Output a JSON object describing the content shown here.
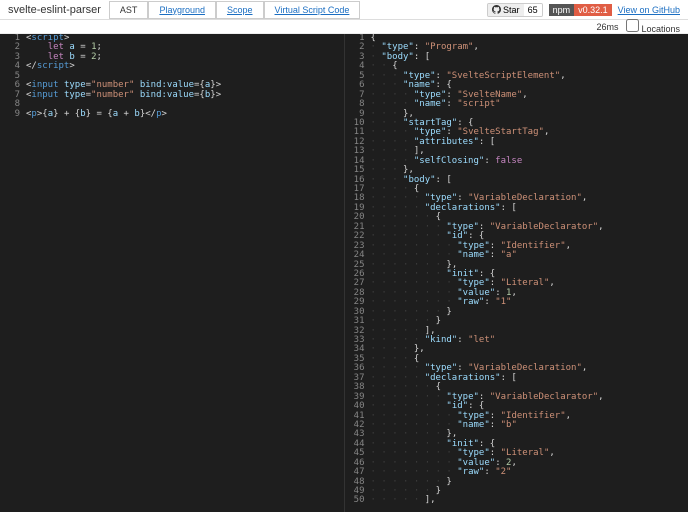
{
  "header": {
    "title": "svelte-eslint-parser",
    "tabs": [
      "AST",
      "Playground",
      "Scope",
      "Virtual Script Code"
    ],
    "activeTab": 0,
    "github": {
      "label": "Star",
      "count": "65"
    },
    "npm": {
      "name": "npm",
      "version": "v0.32.1"
    },
    "viewLink": "View on GitHub"
  },
  "stats": {
    "time": "26ms",
    "locationsLabel": "Locations"
  },
  "leftEditor": [
    {
      "n": 1,
      "h": "<span class='tok-punc'>&lt;</span><span class='tok-tag'>script</span><span class='tok-punc'>&gt;</span>"
    },
    {
      "n": 2,
      "h": "    <span class='tok-kw'>let</span> <span class='tok-var'>a</span> = <span class='tok-num'>1</span>;"
    },
    {
      "n": 3,
      "h": "    <span class='tok-kw'>let</span> <span class='tok-var'>b</span> = <span class='tok-num'>2</span>;"
    },
    {
      "n": 4,
      "h": "<span class='tok-punc'>&lt;/</span><span class='tok-tag'>script</span><span class='tok-punc'>&gt;</span>"
    },
    {
      "n": 5,
      "h": ""
    },
    {
      "n": 6,
      "h": "<span class='tok-punc'>&lt;</span><span class='tok-tag'>input</span> <span class='tok-attr'>type</span>=<span class='tok-str'>\"number\"</span> <span class='tok-attr'>bind:value</span>={<span class='tok-var'>a</span>}<span class='tok-punc'>&gt;</span>"
    },
    {
      "n": 7,
      "h": "<span class='tok-punc'>&lt;</span><span class='tok-tag'>input</span> <span class='tok-attr'>type</span>=<span class='tok-str'>\"number\"</span> <span class='tok-attr'>bind:value</span>={<span class='tok-var'>b</span>}<span class='tok-punc'>&gt;</span>"
    },
    {
      "n": 8,
      "h": ""
    },
    {
      "n": 9,
      "h": "<span class='tok-punc'>&lt;</span><span class='tok-tag'>p</span><span class='tok-punc'>&gt;</span>{<span class='tok-var'>a</span>} + {<span class='tok-var'>b</span>} = {<span class='tok-var'>a</span> + <span class='tok-var'>b</span>}<span class='tok-punc'>&lt;/</span><span class='tok-tag'>p</span><span class='tok-punc'>&gt;</span>"
    }
  ],
  "rightEditor": [
    {
      "n": 1,
      "i": 0,
      "t": "{"
    },
    {
      "n": 2,
      "i": 1,
      "t": "\"type\": \"Program\","
    },
    {
      "n": 3,
      "i": 1,
      "t": "\"body\": ["
    },
    {
      "n": 4,
      "i": 2,
      "t": "{"
    },
    {
      "n": 5,
      "i": 3,
      "t": "\"type\": \"SvelteScriptElement\","
    },
    {
      "n": 6,
      "i": 3,
      "t": "\"name\": {"
    },
    {
      "n": 7,
      "i": 4,
      "t": "\"type\": \"SvelteName\","
    },
    {
      "n": 8,
      "i": 4,
      "t": "\"name\": \"script\""
    },
    {
      "n": 9,
      "i": 3,
      "t": "},"
    },
    {
      "n": 10,
      "i": 3,
      "t": "\"startTag\": {"
    },
    {
      "n": 11,
      "i": 4,
      "t": "\"type\": \"SvelteStartTag\","
    },
    {
      "n": 12,
      "i": 4,
      "t": "\"attributes\": ["
    },
    {
      "n": 13,
      "i": 4,
      "t": "],"
    },
    {
      "n": 14,
      "i": 4,
      "t": "\"selfClosing\": false"
    },
    {
      "n": 15,
      "i": 3,
      "t": "},"
    },
    {
      "n": 16,
      "i": 3,
      "t": "\"body\": ["
    },
    {
      "n": 17,
      "i": 4,
      "t": "{"
    },
    {
      "n": 18,
      "i": 5,
      "t": "\"type\": \"VariableDeclaration\","
    },
    {
      "n": 19,
      "i": 5,
      "t": "\"declarations\": ["
    },
    {
      "n": 20,
      "i": 6,
      "t": "{"
    },
    {
      "n": 21,
      "i": 7,
      "t": "\"type\": \"VariableDeclarator\","
    },
    {
      "n": 22,
      "i": 7,
      "t": "\"id\": {"
    },
    {
      "n": 23,
      "i": 8,
      "t": "\"type\": \"Identifier\","
    },
    {
      "n": 24,
      "i": 8,
      "t": "\"name\": \"a\""
    },
    {
      "n": 25,
      "i": 7,
      "t": "},"
    },
    {
      "n": 26,
      "i": 7,
      "t": "\"init\": {"
    },
    {
      "n": 27,
      "i": 8,
      "t": "\"type\": \"Literal\","
    },
    {
      "n": 28,
      "i": 8,
      "t": "\"value\": 1,"
    },
    {
      "n": 29,
      "i": 8,
      "t": "\"raw\": \"1\""
    },
    {
      "n": 30,
      "i": 7,
      "t": "}"
    },
    {
      "n": 31,
      "i": 6,
      "t": "}"
    },
    {
      "n": 32,
      "i": 5,
      "t": "],"
    },
    {
      "n": 33,
      "i": 5,
      "t": "\"kind\": \"let\""
    },
    {
      "n": 34,
      "i": 4,
      "t": "},"
    },
    {
      "n": 35,
      "i": 4,
      "t": "{"
    },
    {
      "n": 36,
      "i": 5,
      "t": "\"type\": \"VariableDeclaration\","
    },
    {
      "n": 37,
      "i": 5,
      "t": "\"declarations\": ["
    },
    {
      "n": 38,
      "i": 6,
      "t": "{"
    },
    {
      "n": 39,
      "i": 7,
      "t": "\"type\": \"VariableDeclarator\","
    },
    {
      "n": 40,
      "i": 7,
      "t": "\"id\": {"
    },
    {
      "n": 41,
      "i": 8,
      "t": "\"type\": \"Identifier\","
    },
    {
      "n": 42,
      "i": 8,
      "t": "\"name\": \"b\""
    },
    {
      "n": 43,
      "i": 7,
      "t": "},"
    },
    {
      "n": 44,
      "i": 7,
      "t": "\"init\": {"
    },
    {
      "n": 45,
      "i": 8,
      "t": "\"type\": \"Literal\","
    },
    {
      "n": 46,
      "i": 8,
      "t": "\"value\": 2,"
    },
    {
      "n": 47,
      "i": 8,
      "t": "\"raw\": \"2\""
    },
    {
      "n": 48,
      "i": 7,
      "t": "}"
    },
    {
      "n": 49,
      "i": 6,
      "t": "}"
    },
    {
      "n": 50,
      "i": 5,
      "t": "],"
    }
  ]
}
